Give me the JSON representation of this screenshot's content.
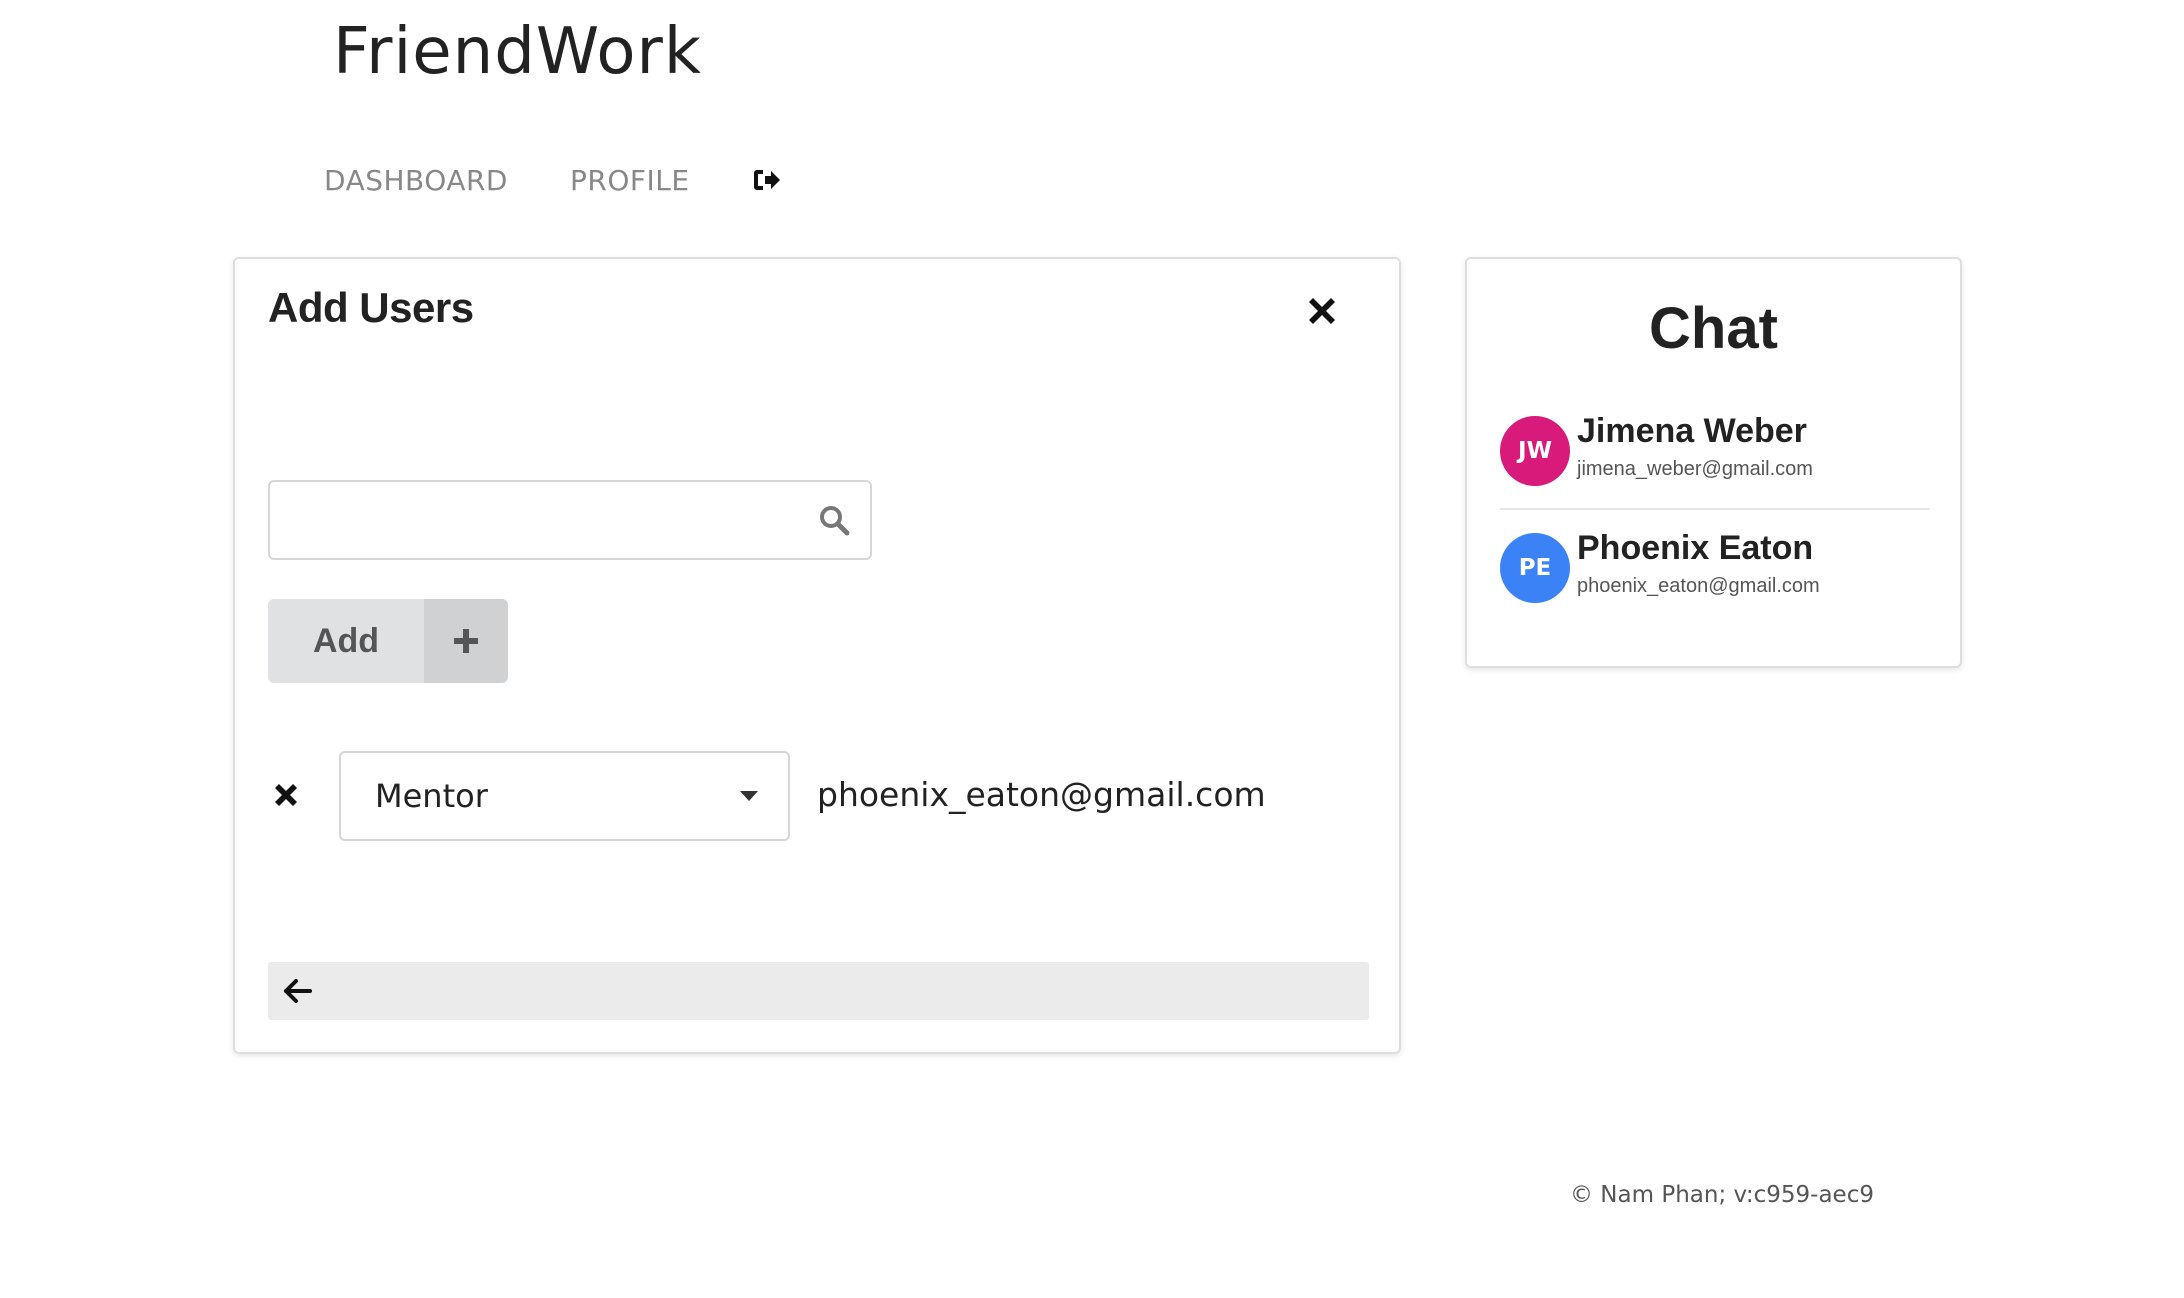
{
  "app": {
    "title": "FriendWork"
  },
  "nav": {
    "items": [
      {
        "label": "DASHBOARD"
      },
      {
        "label": "PROFILE"
      }
    ],
    "logout_icon": "sign-out-icon"
  },
  "add_users": {
    "title": "Add Users",
    "close_icon": "close-icon",
    "search": {
      "value": "",
      "placeholder": "",
      "icon": "search-icon"
    },
    "add_button": {
      "label": "Add",
      "icon": "plus-icon"
    },
    "rows": [
      {
        "remove_icon": "remove-icon",
        "role": "Mentor",
        "email": "phoenix_eaton@gmail.com"
      }
    ],
    "back_icon": "arrow-left-icon"
  },
  "chat": {
    "title": "Chat",
    "contacts": [
      {
        "initials": "JW",
        "name": "Jimena Weber",
        "email": "jimena_weber@gmail.com",
        "avatar_color": "#d81b7a"
      },
      {
        "initials": "PE",
        "name": "Phoenix Eaton",
        "email": "phoenix_eaton@gmail.com",
        "avatar_color": "#3b82f6"
      }
    ]
  },
  "footer": {
    "text": "© Nam Phan; v:c959-aec9"
  },
  "colors": {
    "button_bg": "#e0e1e2",
    "button_icon_bg": "#d0d1d2",
    "back_bar_bg": "#ebebeb",
    "nav_text": "#888888"
  }
}
